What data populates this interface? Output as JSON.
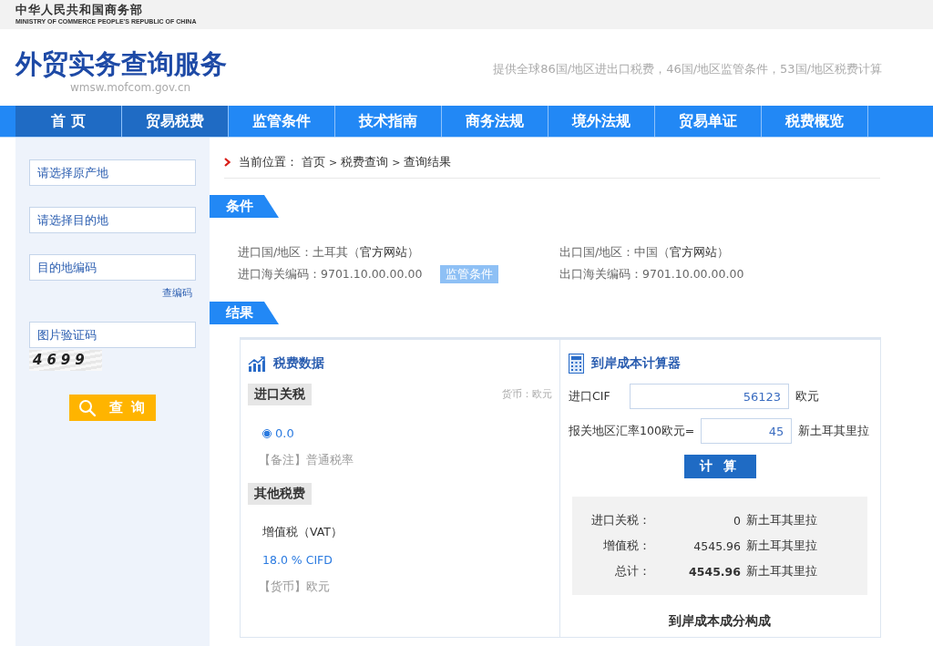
{
  "topbar": {
    "name": "中华人民共和国商务部",
    "name_en": "MINISTRY OF COMMERCE PEOPLE'S REPUBLIC OF CHINA"
  },
  "header": {
    "title": "外贸实务查询服务",
    "domain": "wmsw.mofcom.gov.cn",
    "tagline": "提供全球86国/地区进出口税费，46国/地区监管条件，53国/地区税费计算"
  },
  "nav": [
    {
      "label": "首 页",
      "selected": true
    },
    {
      "label": "贸易税费",
      "selected": true
    },
    {
      "label": "监管条件",
      "selected": false
    },
    {
      "label": "技术指南",
      "selected": false
    },
    {
      "label": "商务法规",
      "selected": false
    },
    {
      "label": "境外法规",
      "selected": false
    },
    {
      "label": "贸易单证",
      "selected": false
    },
    {
      "label": "税费概览",
      "selected": false
    }
  ],
  "sidebar": {
    "origin_placeholder": "请选择原产地",
    "destination_placeholder": "请选择目的地",
    "code_placeholder": "目的地编码",
    "code_link": "查编码",
    "captcha_placeholder": "图片验证码",
    "captcha": "4699",
    "search_button": "查 询"
  },
  "breadcrumb": {
    "prefix": "当前位置：",
    "items": [
      "首页",
      "税费查询",
      "查询结果"
    ],
    "separator": ">"
  },
  "conditions": {
    "heading": "条件",
    "import_country_label": "进口国/地区：土耳其（",
    "import_link": "官方网站",
    "import_close": "）",
    "import_code": "进口海关编码：9701.10.00.00.00",
    "regulation_button": "监管条件",
    "export_country_label": "出口国/地区：中国（",
    "export_link": "官方网站",
    "export_close": "）",
    "export_code": "出口海关编码：9701.10.00.00.00"
  },
  "results": {
    "heading": "结果",
    "tax_data": {
      "title": "税费数据",
      "import_duty_tag": "进口关税",
      "currency": "货币：欧元",
      "rate_option": {
        "label": "0.0",
        "selected": true
      },
      "note": "【备注】普通税率",
      "other_tag": "其他税费",
      "vat_name": "增值税（VAT）",
      "vat_rate": "18.0 % CIFD",
      "vat_currency": "【货币】欧元"
    },
    "calculator": {
      "title": "到岸成本计算器",
      "cif_label": "进口CIF",
      "cif_value": "56123",
      "cif_unit": "欧元",
      "rate_label": "报关地区汇率100欧元=",
      "rate_value": "45",
      "rate_unit": "新土耳其里拉",
      "button": "计 算",
      "summary": [
        {
          "label": "进口关税：",
          "value": "0",
          "unit": "新土耳其里拉",
          "bold": false
        },
        {
          "label": "增值税：",
          "value": "4545.96",
          "unit": "新土耳其里拉",
          "bold": false
        },
        {
          "label": "总计：",
          "value": "4545.96",
          "unit": "新土耳其里拉",
          "bold": true
        }
      ],
      "composition_title": "到岸成本成分构成"
    }
  }
}
